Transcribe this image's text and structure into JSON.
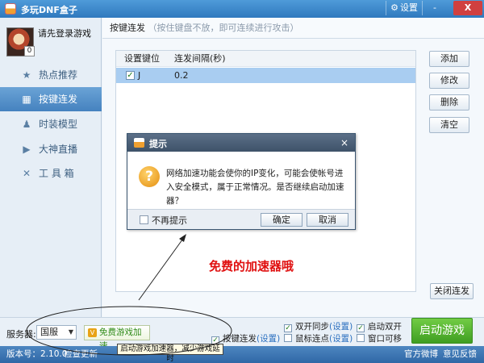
{
  "app": {
    "title": "多玩DNF盒子",
    "settings_label": "设置",
    "min_label": "-",
    "close_label": "X"
  },
  "sidebar": {
    "login_text": "请先登录游戏",
    "avatar_badge": "0",
    "items": [
      {
        "icon": "star-icon",
        "label": "热点推荐"
      },
      {
        "icon": "keyboard-icon",
        "label": "按键连发",
        "active": true
      },
      {
        "icon": "shirt-icon",
        "label": "时装模型"
      },
      {
        "icon": "play-icon",
        "label": "大神直播"
      },
      {
        "icon": "tools-icon",
        "label": "工 具 箱"
      }
    ]
  },
  "main": {
    "breadcrumb_title": "按键连发",
    "breadcrumb_hint": "（按住键盘不放，即可连续进行攻击）",
    "table": {
      "headers": [
        "设置键位",
        "连发间隔(秒)"
      ],
      "rows": [
        {
          "checked": true,
          "key": "J",
          "interval": "0.2"
        }
      ]
    },
    "buttons": {
      "add": "添加",
      "edit": "修改",
      "delete": "删除",
      "clear": "清空",
      "close_burst": "关闭连发"
    },
    "promo_text": "免费的加速器哦"
  },
  "dialog": {
    "title": "提示",
    "close": "×",
    "icon": "question-icon",
    "message": "网络加速功能会使你的IP变化，可能会使帐号进入安全模式，属于正常情况。是否继续启动加速器？",
    "no_more_label": "不再提示",
    "ok_label": "确定",
    "cancel_label": "取消"
  },
  "bottom": {
    "server_label": "服务器:",
    "server_value": "国服",
    "accel_label": "免费游戏加速",
    "key_burst_label": "按键连发",
    "key_burst_link": "(设置)",
    "dual_sync_label": "双开同步",
    "dual_sync_link": "(设置)",
    "mouse_click_label": "鼠标连点",
    "mouse_click_link": "(设置)",
    "auto_dual_label": "启动双开",
    "window_move_label": "窗口可移",
    "start_label": "启动游戏",
    "tooltip": "启动游戏加速器，减少游戏延时"
  },
  "status": {
    "version": "版本号：2.10.0",
    "check_update": "检查更新",
    "weibo": "官方微博",
    "feedback": "意见反馈"
  },
  "colors": {
    "titlebar": "#3a86c8",
    "accent": "#4582bf",
    "promo": "#e01010",
    "start": "#4fae2a"
  }
}
